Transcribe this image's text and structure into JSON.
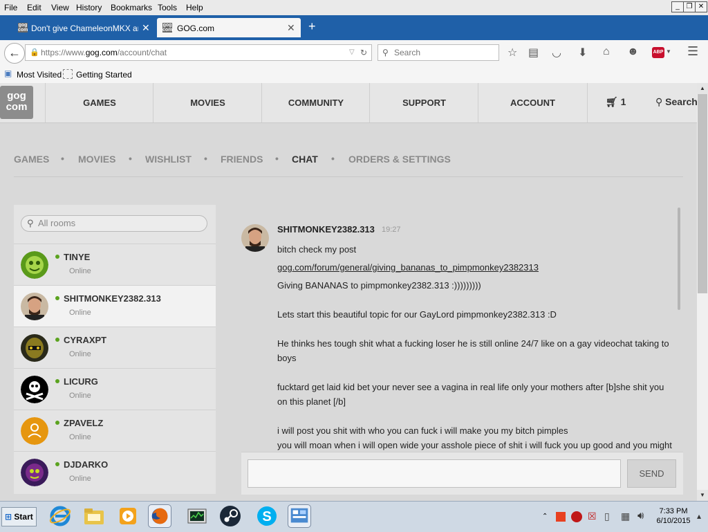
{
  "browser": {
    "menu": [
      "File",
      "Edit",
      "View",
      "History",
      "Bookmarks",
      "Tools",
      "Help"
    ],
    "tabs": [
      {
        "title": "Don't give ChameleonMKX an..."
      },
      {
        "title": "GOG.com"
      }
    ],
    "url_prefix": "https://www.",
    "url_domain": "gog.com",
    "url_path": "/account/chat",
    "search_placeholder": "Search",
    "bookmarks": [
      "Most Visited",
      "Getting Started"
    ],
    "abp_label": "ABP"
  },
  "gog": {
    "logo_top": "gog",
    "logo_bottom": "com",
    "nav": [
      "GAMES",
      "MOVIES",
      "COMMUNITY",
      "SUPPORT",
      "ACCOUNT"
    ],
    "cart_count": "1",
    "search_label": "Search",
    "subnav": [
      "GAMES",
      "MOVIES",
      "WISHLIST",
      "FRIENDS",
      "CHAT",
      "ORDERS & SETTINGS"
    ],
    "subnav_active": "CHAT"
  },
  "rooms": {
    "search_placeholder": "All rooms",
    "items": [
      {
        "name": "TINYE",
        "status": "Online"
      },
      {
        "name": "SHITMONKEY2382.313",
        "status": "Online"
      },
      {
        "name": "CYRAXPT",
        "status": "Online"
      },
      {
        "name": "LICURG",
        "status": "Online"
      },
      {
        "name": "ZPAVELZ",
        "status": "Online"
      },
      {
        "name": "DJDARKO",
        "status": "Online"
      }
    ]
  },
  "chat": {
    "author": "SHITMONKEY2382.313",
    "time": "19:27",
    "lines": [
      "bitch check my post",
      "gog.com/forum/general/giving_bananas_to_pimpmonkey2382313",
      "Giving BANANAS to pimpmonkey2382.313 :)))))))))",
      "",
      "Lets start this beautiful topic for our GayLord pimpmonkey2382.313 :D",
      "",
      "He thinks hes tough shit what a fucking loser he is still online 24/7 like on a gay videochat taking to boys",
      "",
      "fucktard get laid kid bet your never see a vagina in real life only your mothers after [b]she shit you on this planet [/b]",
      "",
      "i will post you shit with who you can fuck i will make you my bitch pimples",
      "you will moan when i will open wide your asshole piece of shit i will fuck you up good and you might"
    ],
    "send_label": "SEND"
  },
  "taskbar": {
    "start_label": "Start",
    "time": "7:33 PM",
    "date": "6/10/2015"
  },
  "colors": {
    "firefox_tabbar": "#1f60a8",
    "online_green": "#5ba31f",
    "gog_gray": "#8c8c8c"
  }
}
